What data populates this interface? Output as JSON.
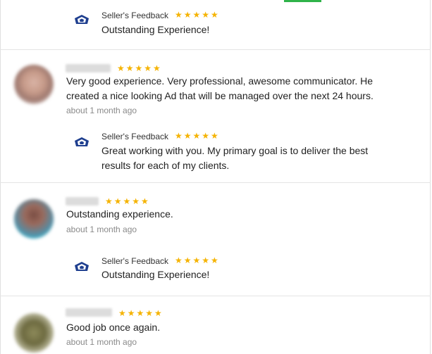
{
  "seller_feedback_label": "Seller's Feedback",
  "colors": {
    "star": "#f5b301",
    "accent_tab": "#2fb34a",
    "time_text": "#8a8a8a"
  },
  "reviews": [
    {
      "rating": 5,
      "seller_reply": {
        "label": "Seller's Feedback",
        "rating": 5,
        "text": "Outstanding Experience!"
      }
    },
    {
      "rating": 5,
      "text_line1": "Very good experience. Very professional, awesome communicator. He",
      "text_line2": "created a nice looking Ad that will be managed over the next 24 hours.",
      "time": "about 1 month ago",
      "seller_reply": {
        "label": "Seller's Feedback",
        "rating": 5,
        "text_line1": "Great working with you. My primary goal is to deliver the best",
        "text_line2": "results for each of my clients."
      }
    },
    {
      "rating": 5,
      "text": "Outstanding experience.",
      "time": "about 1 month ago",
      "seller_reply": {
        "label": "Seller's Feedback",
        "rating": 5,
        "text": "Outstanding Experience!"
      }
    },
    {
      "rating": 5,
      "text": "Good job once again.",
      "time": "about 1 month ago"
    }
  ],
  "star_glyph": "★★★★★"
}
